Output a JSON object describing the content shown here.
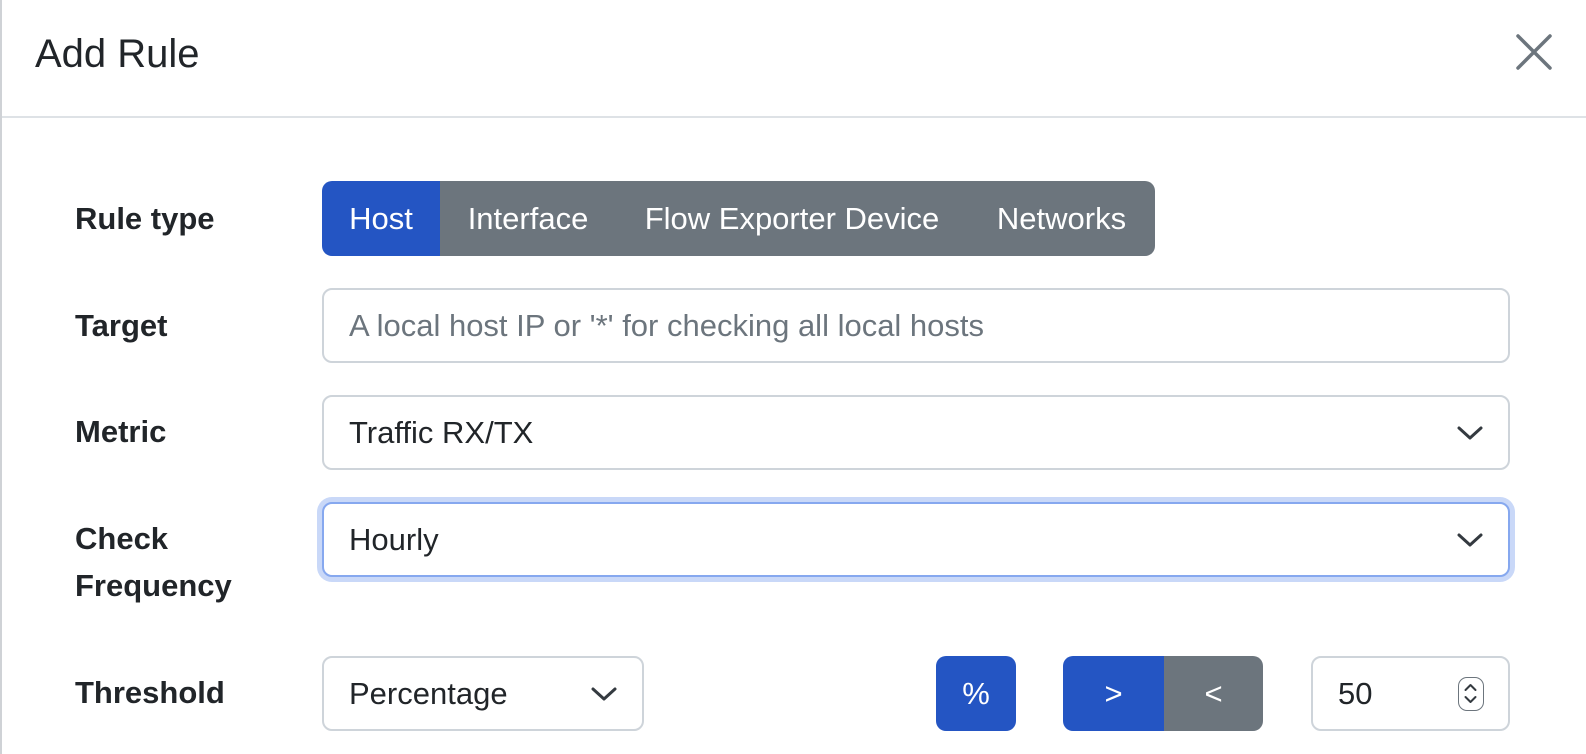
{
  "modal": {
    "title": "Add Rule"
  },
  "form": {
    "rule_type": {
      "label": "Rule type",
      "options": [
        "Host",
        "Interface",
        "Flow Exporter Device",
        "Networks"
      ],
      "selected": "Host"
    },
    "target": {
      "label": "Target",
      "value": "",
      "placeholder": "A local host IP or '*' for checking all local hosts"
    },
    "metric": {
      "label": "Metric",
      "value": "Traffic RX/TX"
    },
    "frequency": {
      "label_line1": "Check",
      "label_line2": "Frequency",
      "value": "Hourly"
    },
    "threshold": {
      "label": "Threshold",
      "type_value": "Percentage",
      "unit_label": "%",
      "operators": [
        ">",
        "<"
      ],
      "selected_operator": ">",
      "value": "50"
    }
  },
  "colors": {
    "primary": "#2455c3",
    "secondary": "#6c757d",
    "focus_ring": "#c9d8f8"
  },
  "icons": {
    "close": "close-icon",
    "dropdown": "chevron-down-icon",
    "spinner": "spinner-arrows-icon"
  }
}
